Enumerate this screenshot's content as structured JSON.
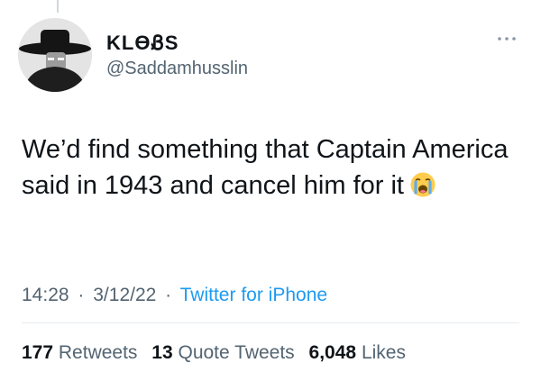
{
  "tweet": {
    "author": {
      "display_name": "KLƟᏰS",
      "handle": "@Saddamhusslin",
      "avatar_icon": "avatar-silhouette-wide-brim-hat"
    },
    "text": "We’d find something that Captain America said in 1943 and cancel him for it",
    "emoji": "😭",
    "time": "14:28",
    "date": "3/12/22",
    "separator": "·",
    "source": "Twitter for iPhone",
    "more_icon": "more-dots-icon",
    "stats": {
      "retweets_count": "177",
      "retweets_label": "Retweets",
      "quote_tweets_count": "13",
      "quote_tweets_label": "Quote Tweets",
      "likes_count": "6,048",
      "likes_label": "Likes"
    }
  },
  "colors": {
    "text_primary": "#0f1419",
    "text_secondary": "#536471",
    "link": "#1d9bf0",
    "divider": "#e7ecef"
  }
}
